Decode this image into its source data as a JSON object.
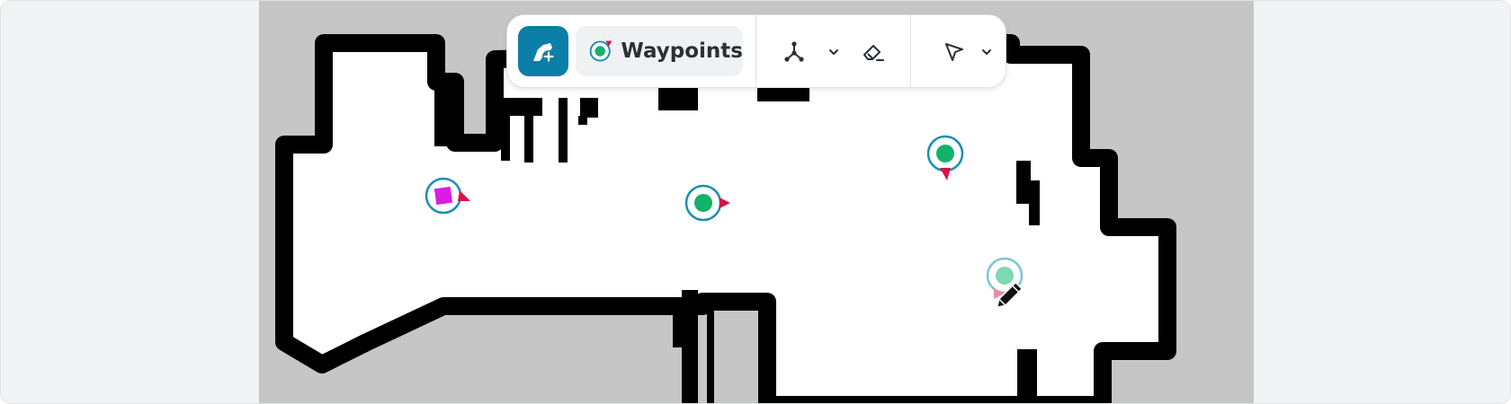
{
  "toolbar": {
    "add_button": {
      "icon": "map-add-icon"
    },
    "waypoints_pill": {
      "label": "Waypoints",
      "icon": "waypoint-icon"
    },
    "nodes_button": {
      "icon": "nodes-icon"
    },
    "nodes_dropdown": {
      "icon": "chevron-down-icon"
    },
    "eraser_button": {
      "icon": "eraser-icon"
    },
    "select_button": {
      "icon": "cursor-arrow-icon"
    },
    "select_dropdown": {
      "icon": "chevron-down-icon"
    }
  },
  "map": {
    "markers": [
      {
        "kind": "start",
        "color": "#d81ee6"
      },
      {
        "kind": "waypoint",
        "color": "#12b26b"
      },
      {
        "kind": "waypoint",
        "color": "#12b26b"
      },
      {
        "kind": "waypoint-ghost",
        "color": "#7ed9b4"
      }
    ]
  },
  "colors": {
    "accent": "#0b7fa8",
    "waypoint": "#12b26b",
    "heading_arrow": "#d81447",
    "start_marker": "#d81ee6",
    "wall": "#000000",
    "unknown_area": "#c6c6c6",
    "free_space": "#ffffff"
  }
}
